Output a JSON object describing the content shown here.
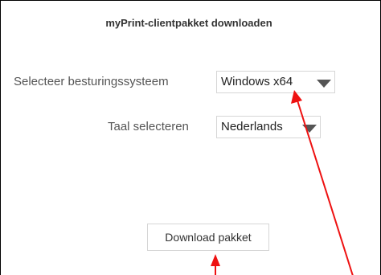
{
  "dialog": {
    "title": "myPrint-clientpakket downloaden"
  },
  "os": {
    "label": "Selecteer besturingssysteem",
    "selected": "Windows x64"
  },
  "language": {
    "label": "Taal selecteren",
    "selected": "Nederlands"
  },
  "download": {
    "button_label": "Download pakket"
  },
  "annotation": {
    "arrow_color": "#ee1111"
  }
}
